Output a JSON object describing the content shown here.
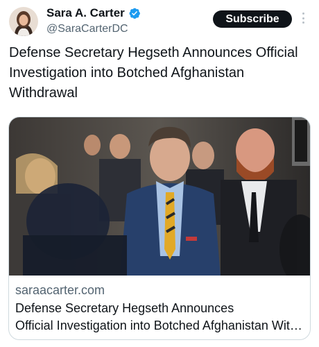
{
  "author": {
    "display_name": "Sara A. Carter",
    "handle": "@SaraCarterDC",
    "verified": true,
    "avatar_icon": "profile-photo"
  },
  "actions": {
    "subscribe_label": "Subscribe",
    "more_icon": "more-vertical-icon"
  },
  "tweet": {
    "text": "Defense Secretary Hegseth Announces Official Investigation into Botched Afghanistan Withdrawal"
  },
  "card": {
    "domain": "saraacarter.com",
    "title_line1": "Defense Secretary Hegseth Announces",
    "title_line2": "Official Investigation into Botched Afghanistan Withdrawal"
  },
  "colors": {
    "text_primary": "#0f1419",
    "text_secondary": "#536471",
    "verified_blue": "#1d9bf0",
    "border": "#cfd9de"
  }
}
